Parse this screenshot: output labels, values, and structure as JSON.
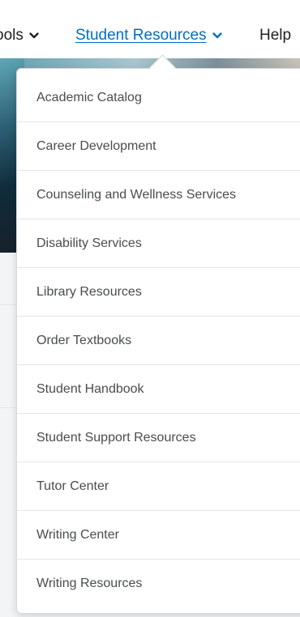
{
  "nav": {
    "items": [
      {
        "label": "Tools",
        "visible_text": "ools",
        "has_chevron": true
      },
      {
        "label": "Student Resources",
        "has_chevron": true,
        "active": true
      },
      {
        "label": "Help",
        "has_chevron": false
      }
    ]
  },
  "dropdown": {
    "items": [
      "Academic Catalog",
      "Career Development",
      "Counseling and Wellness Services",
      "Disability Services",
      "Library Resources",
      "Order Textbooks",
      "Student Handbook",
      "Student Support Resources",
      "Tutor Center",
      "Writing Center",
      "Writing Resources"
    ]
  },
  "colors": {
    "link": "#006fbf",
    "text": "#494c4e",
    "nav_text": "#202122"
  },
  "icons": {
    "chevron": "chevron-down-icon"
  }
}
